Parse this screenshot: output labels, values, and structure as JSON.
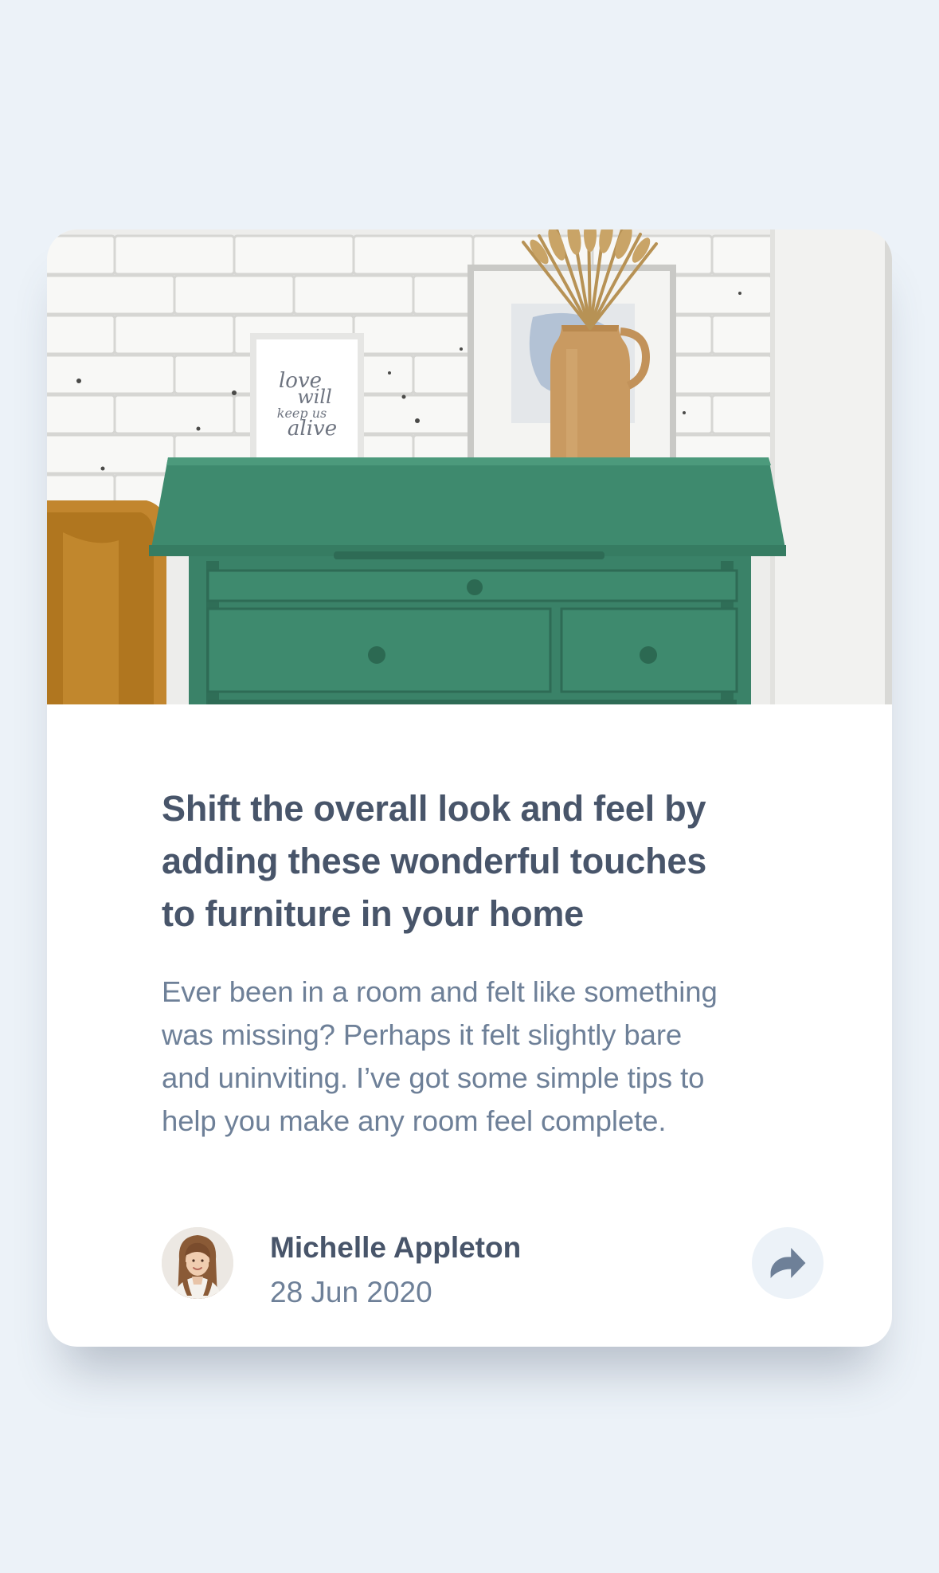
{
  "article": {
    "title_line_1": "Shift the overall look and feel by",
    "title_line_2": "adding these wonderful touches",
    "title_line_3": "to furniture in your home",
    "excerpt_line_1": "Ever been in a room and felt like something",
    "excerpt_line_2": "was missing? Perhaps it felt slightly bare",
    "excerpt_line_3": "and uninviting. I’ve got some simple tips to",
    "excerpt_line_4": "help you make any room feel complete."
  },
  "hero": {
    "frame_text_1": "love",
    "frame_text_2": "will",
    "frame_text_3": "keep us",
    "frame_text_4": "alive"
  },
  "author": {
    "name": "Michelle Appleton",
    "date": "28 Jun 2020"
  },
  "icons": {
    "share": "share-icon",
    "avatar": "avatar-photo"
  },
  "colors": {
    "page_background": "#ECF2F8",
    "card_background": "#FFFFFF",
    "title_text": "#48556A",
    "body_text": "#6E8098",
    "share_button_bg": "#ECF2F8",
    "share_icon": "#6E8098",
    "dresser_green": "#3E8A6E"
  }
}
